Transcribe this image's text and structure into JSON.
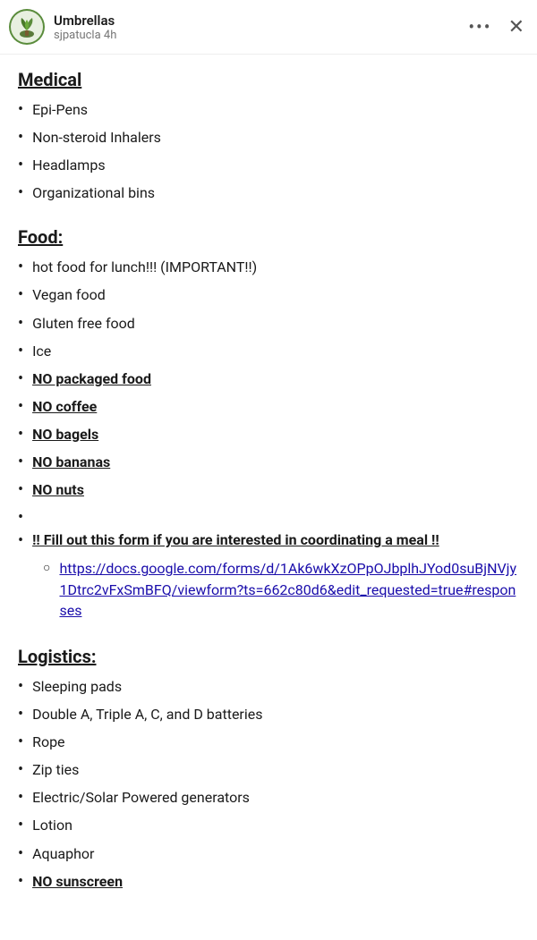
{
  "header": {
    "title": "Umbrellas",
    "username": "sjpatucla",
    "time": "4h",
    "dots_label": "•••",
    "close_label": "✕"
  },
  "sections": {
    "medical": {
      "title": "Medical",
      "items": [
        "Epi-Pens",
        "Non-steroid Inhalers",
        "Headlamps",
        "Organizational bins"
      ]
    },
    "food": {
      "title": "Food:",
      "items": [
        "hot food for lunch!!! (IMPORTANT!!)",
        "Vegan food",
        "Gluten free food",
        "Ice",
        "NO packaged food",
        "NO coffee",
        "NO bagels",
        "NO bananas",
        "NO nuts"
      ],
      "underline_items": [
        "NO packaged food",
        "NO coffee",
        "NO bagels",
        "NO bananas",
        "NO nuts"
      ],
      "fill_form": "!! Fill out this form if you are interested in coordinating a meal !!",
      "link": "https://docs.google.com/forms/d/1Ak6wkXzOPpOJbplhJYod0suBjNVjy1Dtrc2vFxSmBFQ/viewform?ts=662c80d6&edit_requested=true#responses"
    },
    "logistics": {
      "title": "Logistics:",
      "items": [
        "Sleeping pads",
        "Double A, Triple A, C, and D batteries",
        "Rope",
        "Zip ties",
        "Electric/Solar Powered generators",
        "Lotion",
        "Aquaphor",
        "NO sunscreen"
      ],
      "underline_items": [
        "NO sunscreen"
      ]
    }
  }
}
